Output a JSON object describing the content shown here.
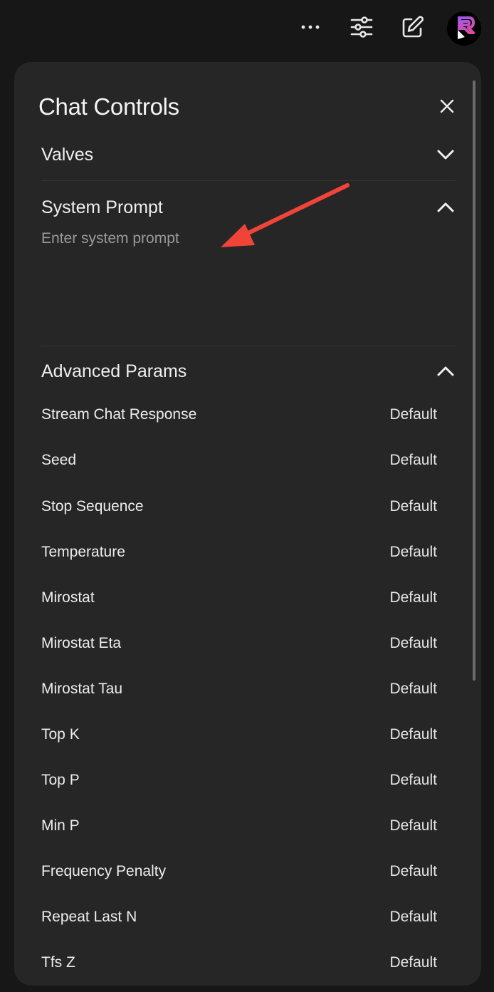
{
  "panel": {
    "title": "Chat Controls"
  },
  "sections": {
    "valves": {
      "label": "Valves"
    },
    "system_prompt": {
      "label": "System Prompt",
      "value": "",
      "placeholder": "Enter system prompt"
    },
    "advanced": {
      "label": "Advanced Params"
    }
  },
  "params": [
    {
      "name": "Stream Chat Response",
      "value": "Default"
    },
    {
      "name": "Seed",
      "value": "Default"
    },
    {
      "name": "Stop Sequence",
      "value": "Default"
    },
    {
      "name": "Temperature",
      "value": "Default"
    },
    {
      "name": "Mirostat",
      "value": "Default"
    },
    {
      "name": "Mirostat Eta",
      "value": "Default"
    },
    {
      "name": "Mirostat Tau",
      "value": "Default"
    },
    {
      "name": "Top K",
      "value": "Default"
    },
    {
      "name": "Top P",
      "value": "Default"
    },
    {
      "name": "Min P",
      "value": "Default"
    },
    {
      "name": "Frequency Penalty",
      "value": "Default"
    },
    {
      "name": "Repeat Last N",
      "value": "Default"
    },
    {
      "name": "Tfs Z",
      "value": "Default"
    }
  ],
  "icons": {
    "more": "more-horizontal-icon",
    "controls": "sliders-icon",
    "new_chat": "edit-icon",
    "close": "close-icon",
    "collapsed": "chevron-down-icon",
    "expanded": "chevron-up-icon"
  },
  "colors": {
    "background": "#171717",
    "panel": "#262626",
    "annotation_arrow": "#f04438",
    "avatar_gradient_start": "#8b5cf6",
    "avatar_gradient_end": "#ec4899"
  }
}
